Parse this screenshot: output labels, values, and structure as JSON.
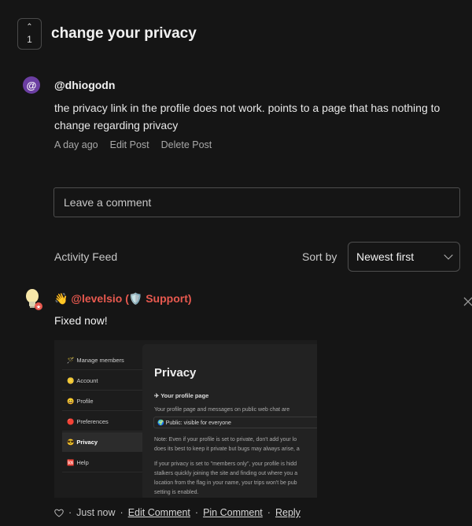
{
  "post": {
    "upvote_count": "1",
    "title": "change your privacy",
    "avatar_char": "@",
    "author": "@dhiogodn",
    "body": "the privacy link in the profile does not work. points to a page that has nothing to change regarding privacy",
    "time": "A day ago",
    "edit_label": "Edit Post",
    "delete_label": "Delete Post"
  },
  "comment_input": {
    "placeholder": "Leave a comment"
  },
  "feed": {
    "label": "Activity Feed",
    "sort_label": "Sort by",
    "sort_value": "Newest first"
  },
  "comment": {
    "author": "👋 @levelsio (🛡️ Support)",
    "text": "Fixed now!",
    "time": "Just now",
    "sep": "·",
    "edit_label": "Edit Comment",
    "pin_label": "Pin Comment",
    "reply_label": "Reply",
    "screenshot": {
      "sidebar": [
        {
          "label": "Manage members",
          "icon": "🪄"
        },
        {
          "label": "Account",
          "icon": "🪙"
        },
        {
          "label": "Profile",
          "icon": "😀"
        },
        {
          "label": "Preferences",
          "icon": "🔴"
        },
        {
          "label": "Privacy",
          "icon": "😎"
        },
        {
          "label": "Help",
          "icon": "🆘"
        }
      ],
      "panel_title": "Privacy",
      "panel_sub": "✈ Your profile page",
      "panel_line1": "Your profile page and messages on public web chat are",
      "panel_select": "🌍 Public: visible for everyone",
      "note_lines": [
        "Note: Even if your profile is set to private, don't add your lo",
        "does its best to keep it private but bugs may always arise, a"
      ],
      "members_lines": [
        "If your privacy is set to \"members only\", your profile is hidd",
        "stalkers quickly joining the site and finding out where you a",
        "location from the flag in your name, your trips won't be pub",
        "setting is enabled."
      ]
    }
  },
  "colors": {
    "accent_red": "#e8594f",
    "avatar_purple": "#6b3ea2",
    "background": "#151515"
  }
}
